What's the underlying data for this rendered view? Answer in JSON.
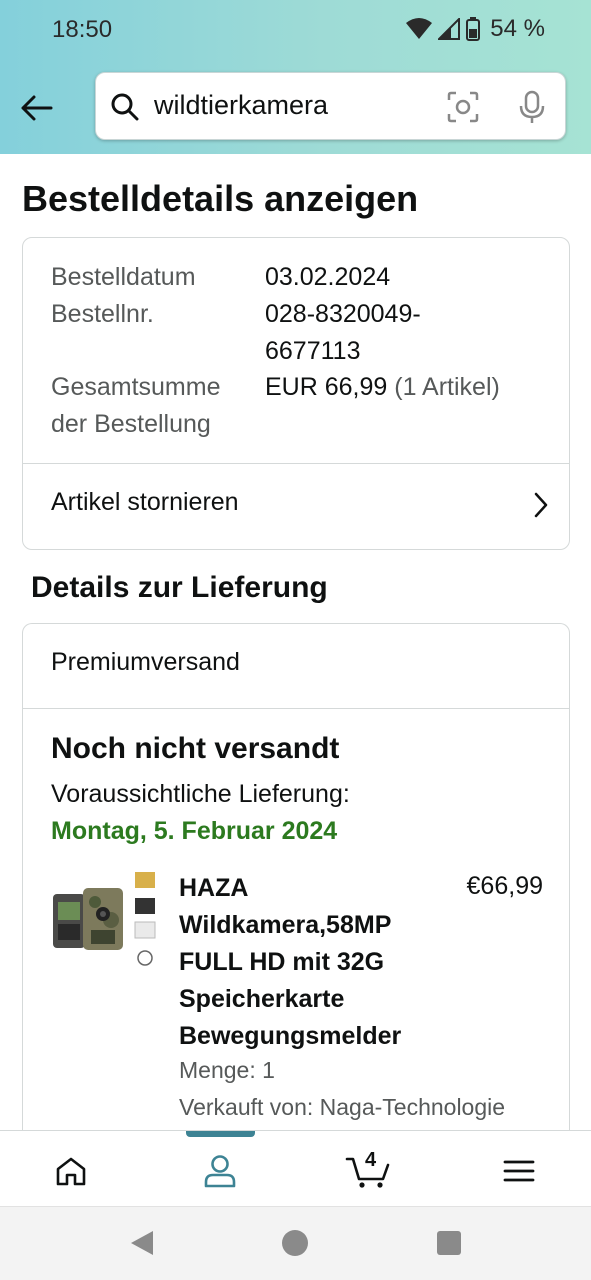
{
  "status_bar": {
    "time": "18:50",
    "battery": "54 %"
  },
  "search": {
    "query": "wildtierkamera"
  },
  "page": {
    "title": "Bestelldetails anzeigen"
  },
  "order": {
    "date_label": "Bestelldatum",
    "date_value": "03.02.2024",
    "number_label": "Bestellnr.",
    "number_value_line1": "028-8320049-",
    "number_value_line2": "6677113",
    "total_label_line1": "Gesamtsumme",
    "total_label_line2": "der Bestellung",
    "total_value": "EUR 66,99",
    "total_items": "(1 Artikel)",
    "cancel_label": "Artikel stornieren"
  },
  "delivery": {
    "section_title": "Details zur Lieferung",
    "shipping_method": "Premiumversand",
    "status": "Noch nicht versandt",
    "estimate_label": "Voraussichtliche Lieferung:",
    "estimate_date": "Montag, 5. Februar 2024",
    "estimate_color": "#2c7a1f"
  },
  "product": {
    "title_line1": "HAZA",
    "title_line2": "Wildkamera,58MP",
    "title_line3": "FULL HD mit 32G",
    "title_line4": "Speicherkarte",
    "title_line5": "Bewegungsmelder",
    "price": "€66,99",
    "quantity": "Menge: 1",
    "seller": "Verkauft von: Naga-Technologie"
  },
  "bottom_nav": {
    "items": [
      "home-icon",
      "account-icon",
      "cart-icon",
      "menu-icon"
    ],
    "active": "account-icon",
    "cart_count": "4",
    "accent": "#3d8394"
  },
  "colors": {
    "header_gradient_start": "#84d0db",
    "header_gradient_end": "#a6e3d4"
  }
}
